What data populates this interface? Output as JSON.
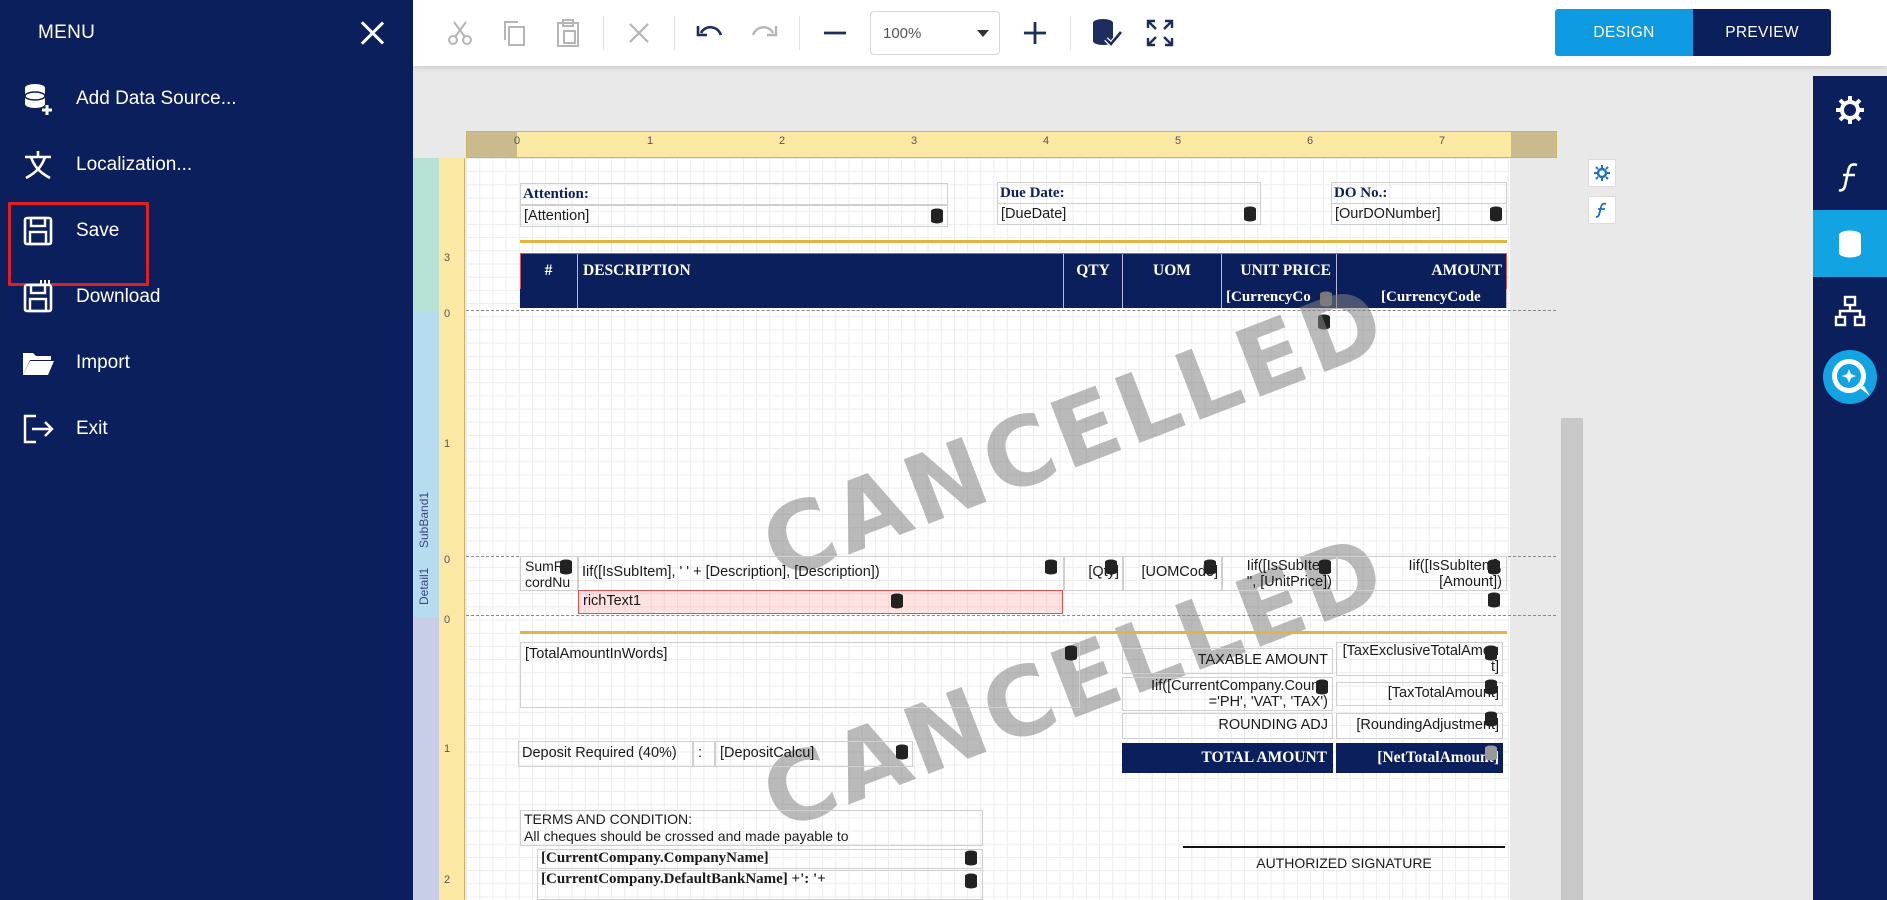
{
  "menu": {
    "title": "MENU",
    "items": [
      {
        "label": "Add Data Source...",
        "icon": "add-database-icon"
      },
      {
        "label": "Localization...",
        "icon": "translate-icon"
      },
      {
        "label": "Save",
        "icon": "save-icon",
        "highlighted": true
      },
      {
        "label": "Download",
        "icon": "download-icon"
      },
      {
        "label": "Import",
        "icon": "folder-open-icon"
      },
      {
        "label": "Exit",
        "icon": "exit-icon"
      }
    ]
  },
  "toolbar": {
    "zoom": "100%",
    "design_label": "DESIGN",
    "preview_label": "PREVIEW"
  },
  "colors": {
    "navy": "#0b1f5c",
    "accent": "#0d9ae0",
    "highlight": "#e02020",
    "gold": "#e0b640"
  },
  "ruler": {
    "h_numbers": [
      "0",
      "1",
      "2",
      "3",
      "4",
      "5",
      "6",
      "7"
    ],
    "v_top_number": "3",
    "v_band2_numbers": [
      "0",
      "1"
    ],
    "v_band3_numbers": [
      "0"
    ],
    "v_band4_numbers": [
      "0",
      "1",
      "2"
    ],
    "band_labels": [
      "SubBand1",
      "Detail1"
    ]
  },
  "report": {
    "attention_label": "Attention:",
    "attention_value": "[Attention]",
    "due_label": "Due Date:",
    "due_value": "[DueDate]",
    "do_label": "DO No.:",
    "do_value": "[OurDONumber]",
    "headers": [
      "#",
      "DESCRIPTION",
      "QTY",
      "UOM",
      "UNIT PRICE",
      "AMOUNT"
    ],
    "currency_1": "[CurrencyCo",
    "currency_2": "[CurrencyCode",
    "watermark": "CANCELLED",
    "detail": {
      "num_line1": "SumR",
      "num_line2": "cordNu",
      "description": "Iif([IsSubItem], '   ' + [Description], [Description])",
      "qty": "[Qty]",
      "uom": "[UOMCode]",
      "unit_price_1": "Iif([IsSubItem",
      "unit_price_2": "'', [UnitPrice])",
      "amount_1": "Iif([IsSubItem],",
      "amount_2": "[Amount])",
      "richtext": "richText1"
    },
    "footer": {
      "amount_words": "[TotalAmountInWords]",
      "taxable_label": "TAXABLE AMOUNT",
      "taxable_value_1": "[TaxExclusiveTotalAmou",
      "taxable_value_2": "t]",
      "tax_label_1": "Iif([CurrentCompany.Countr",
      "tax_label_2": "='PH', 'VAT', 'TAX')",
      "tax_value": "[TaxTotalAmount]",
      "rounding_label": "ROUNDING ADJ",
      "rounding_value": "[RoundingAdjustment]",
      "deposit_label": "Deposit Required (40%)",
      "deposit_colon": ":",
      "deposit_value": "[DepositCalcu]",
      "total_label": "TOTAL AMOUNT",
      "total_value": "[NetTotalAmount]",
      "terms_1": "TERMS AND CONDITION:",
      "terms_2": "All cheques should be crossed and made payable to",
      "company": "[CurrentCompany.CompanyName]",
      "bank": "[CurrentCompany.DefaultBankName] +': '+",
      "signature": "AUTHORIZED SIGNATURE"
    }
  }
}
